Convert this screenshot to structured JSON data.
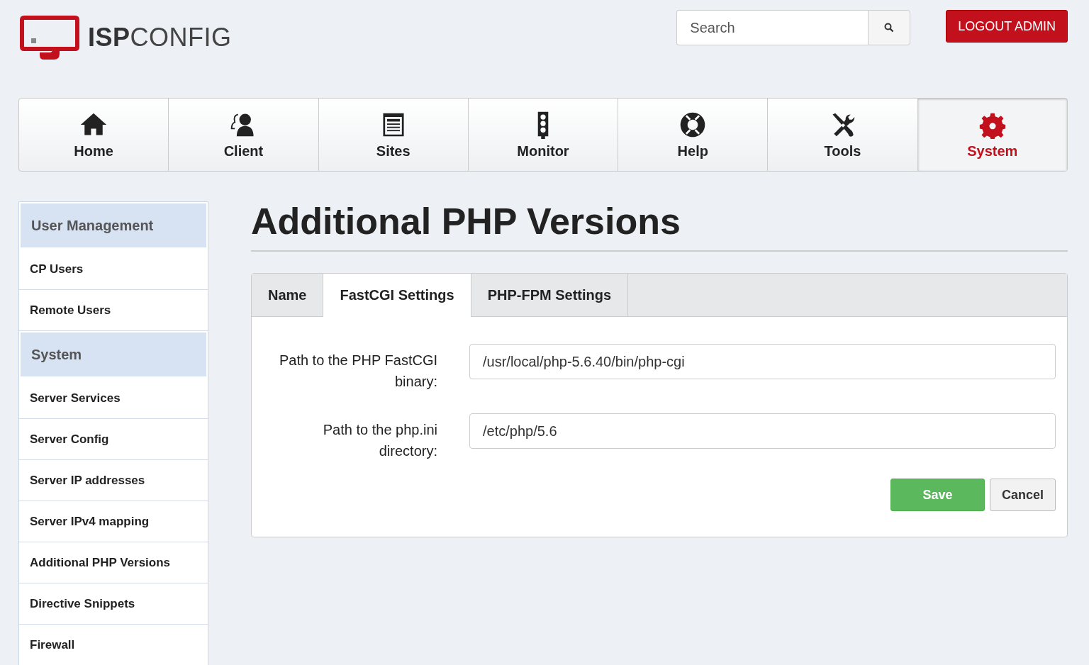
{
  "logo": {
    "text": "**ISP**CONFIG"
  },
  "search": {
    "placeholder": "Search"
  },
  "logout_button": "LOGOUT ADMIN",
  "nav": [
    {
      "label": "Home",
      "kind": "home",
      "selected": false
    },
    {
      "label": "Client",
      "kind": "client",
      "selected": false
    },
    {
      "label": "Sites",
      "kind": "sites",
      "selected": false
    },
    {
      "label": "Monitor",
      "kind": "monitor",
      "selected": false
    },
    {
      "label": "Help",
      "kind": "help",
      "selected": false
    },
    {
      "label": "Tools",
      "kind": "tools",
      "selected": false
    },
    {
      "label": "System",
      "kind": "system",
      "selected": true
    }
  ],
  "sidebar": {
    "items": [
      {
        "label": "User Management",
        "kind": "header"
      },
      {
        "label": "CP Users",
        "kind": "link"
      },
      {
        "label": "Remote Users",
        "kind": "link"
      },
      {
        "label": "System",
        "kind": "header"
      },
      {
        "label": "Server Services",
        "kind": "link"
      },
      {
        "label": "Server Config",
        "kind": "link"
      },
      {
        "label": "Server IP addresses",
        "kind": "link"
      },
      {
        "label": "Server IPv4 mapping",
        "kind": "link"
      },
      {
        "label": "Additional PHP Versions",
        "kind": "link"
      },
      {
        "label": "Directive Snippets",
        "kind": "link"
      },
      {
        "label": "Firewall",
        "kind": "link"
      }
    ]
  },
  "page_title": "Additional PHP Versions",
  "tabs": [
    {
      "label": "Name",
      "selected": false
    },
    {
      "label": "FastCGI Settings",
      "selected": true
    },
    {
      "label": "PHP-FPM Settings",
      "selected": false
    }
  ],
  "fields": [
    {
      "label": "Path to the PHP FastCGI binary:",
      "value": "/usr/local/php-5.6.40/bin/php-cgi"
    },
    {
      "label": "Path to the php.ini directory:",
      "value": "/etc/php/5.6"
    }
  ],
  "buttons": [
    {
      "label": "Save",
      "kind": "primary"
    },
    {
      "label": "Cancel",
      "kind": "secondary"
    }
  ]
}
